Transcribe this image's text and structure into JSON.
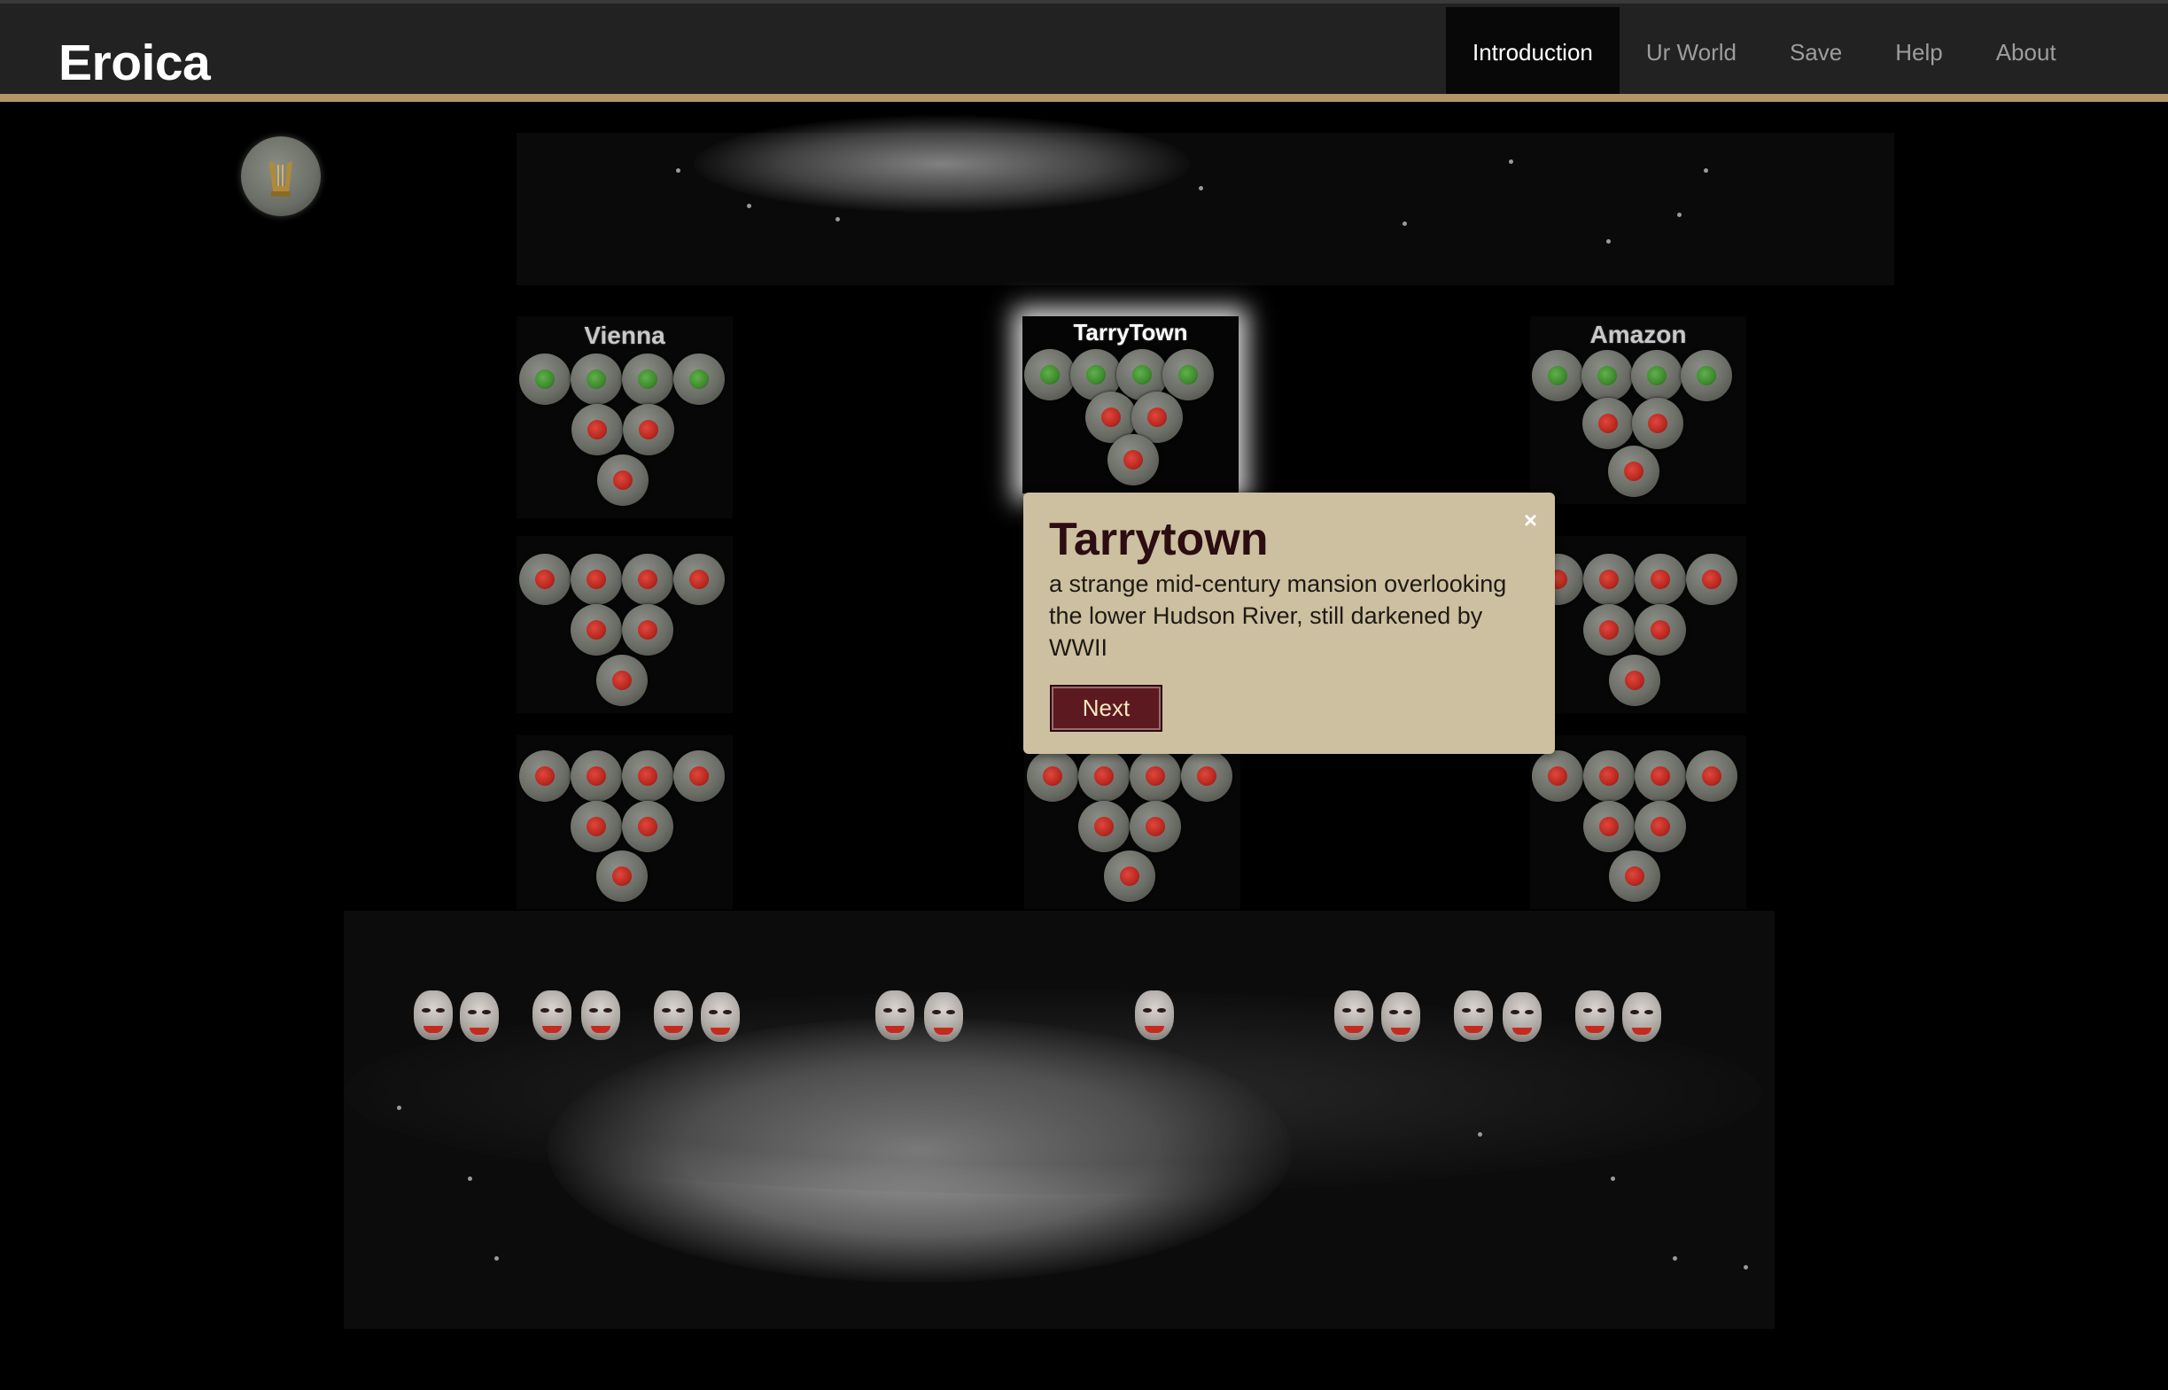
{
  "app": {
    "title": "Eroica"
  },
  "nav": {
    "items": [
      {
        "label": "Introduction",
        "active": true
      },
      {
        "label": "Ur World",
        "active": false
      },
      {
        "label": "Save",
        "active": false
      },
      {
        "label": "Help",
        "active": false
      },
      {
        "label": "About",
        "active": false
      }
    ]
  },
  "board": {
    "locations": [
      {
        "name": "Vienna",
        "nodes": [
          "green",
          "green",
          "green",
          "green",
          "red",
          "red",
          "red"
        ]
      },
      {
        "name": "TarryTown",
        "highlighted": true,
        "nodes": [
          "green",
          "green",
          "green",
          "green",
          "red",
          "red",
          "red"
        ]
      },
      {
        "name": "Amazon",
        "nodes": [
          "green",
          "green",
          "green",
          "green",
          "red",
          "red",
          "red"
        ]
      },
      {
        "name": "",
        "nodes": [
          "red",
          "red",
          "red",
          "red",
          "red",
          "red",
          "red"
        ]
      },
      {
        "name": "",
        "nodes": [
          "red",
          "red",
          "red",
          "red",
          "red",
          "red",
          "red"
        ]
      },
      {
        "name": "",
        "nodes": [
          "red",
          "red",
          "red",
          "red",
          "red",
          "red",
          "red"
        ]
      },
      {
        "name": "",
        "nodes": [
          "red",
          "red",
          "red",
          "red",
          "red",
          "red",
          "red"
        ]
      },
      {
        "name": "",
        "nodes": [
          "red",
          "red",
          "red",
          "red",
          "red",
          "red",
          "red"
        ]
      },
      {
        "name": "",
        "nodes": [
          "red",
          "red",
          "red",
          "red",
          "red",
          "red",
          "red"
        ]
      }
    ],
    "node_colors": {
      "red": "#b8281f",
      "green": "#3e8a2e"
    }
  },
  "popover": {
    "title": "Tarrytown",
    "text": "a strange mid-century mansion overlooking the lower Hudson River, still darkened by WWII",
    "close_label": "×",
    "next_label": "Next"
  },
  "colors": {
    "navbar_bg": "#222222",
    "navbar_accent": "#b39468",
    "popover_bg": "#cdc0a0",
    "button_bg": "#5c1a20"
  }
}
